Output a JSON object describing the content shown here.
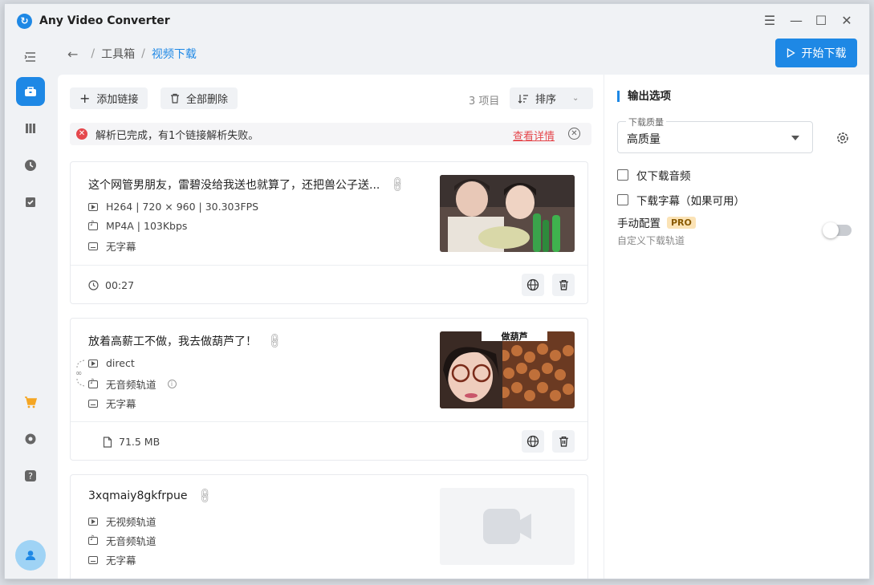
{
  "app": {
    "title": "Any Video Converter"
  },
  "breadcrumb": {
    "parent": "工具箱",
    "current": "视频下载",
    "sep": "/"
  },
  "actions": {
    "start_download": "开始下载"
  },
  "toolbar": {
    "add_link": "添加链接",
    "delete_all": "全部删除",
    "item_count": "3 项目",
    "sort": "排序"
  },
  "alert": {
    "message": "解析已完成，有1个链接解析失败。",
    "details_link": "查看详情"
  },
  "items": [
    {
      "title": "这个网管男朋友，雷碧没给我送也就算了，还把兽公子送...",
      "video": "H264 | 720 × 960 | 30.303FPS",
      "audio": "MP4A | 103Kbps",
      "subtitle": "无字幕",
      "footer": "00:27"
    },
    {
      "title": "放着高薪工不做，我去做葫芦了！",
      "video": "direct",
      "audio": "无音频轨道",
      "subtitle": "无字幕",
      "footer": "71.5 MB",
      "thumb_caption": "做葫芦"
    },
    {
      "title": "3xqmaiy8gkfrpue",
      "video": "无视频轨道",
      "audio": "无音频轨道",
      "subtitle": "无字幕"
    }
  ],
  "output": {
    "section_title": "输出选项",
    "quality_label": "下载质量",
    "quality_value": "高质量",
    "audio_only": "仅下载音频",
    "subtitles": "下载字幕（如果可用）",
    "manual_config": "手动配置",
    "pro_badge": "PRO",
    "manual_desc": "自定义下载轨道",
    "manual_enabled": false
  },
  "colors": {
    "accent": "#1e88e5",
    "error": "#e5484d",
    "panel": "#ffffff",
    "sidebar": "#f0f2f5"
  }
}
